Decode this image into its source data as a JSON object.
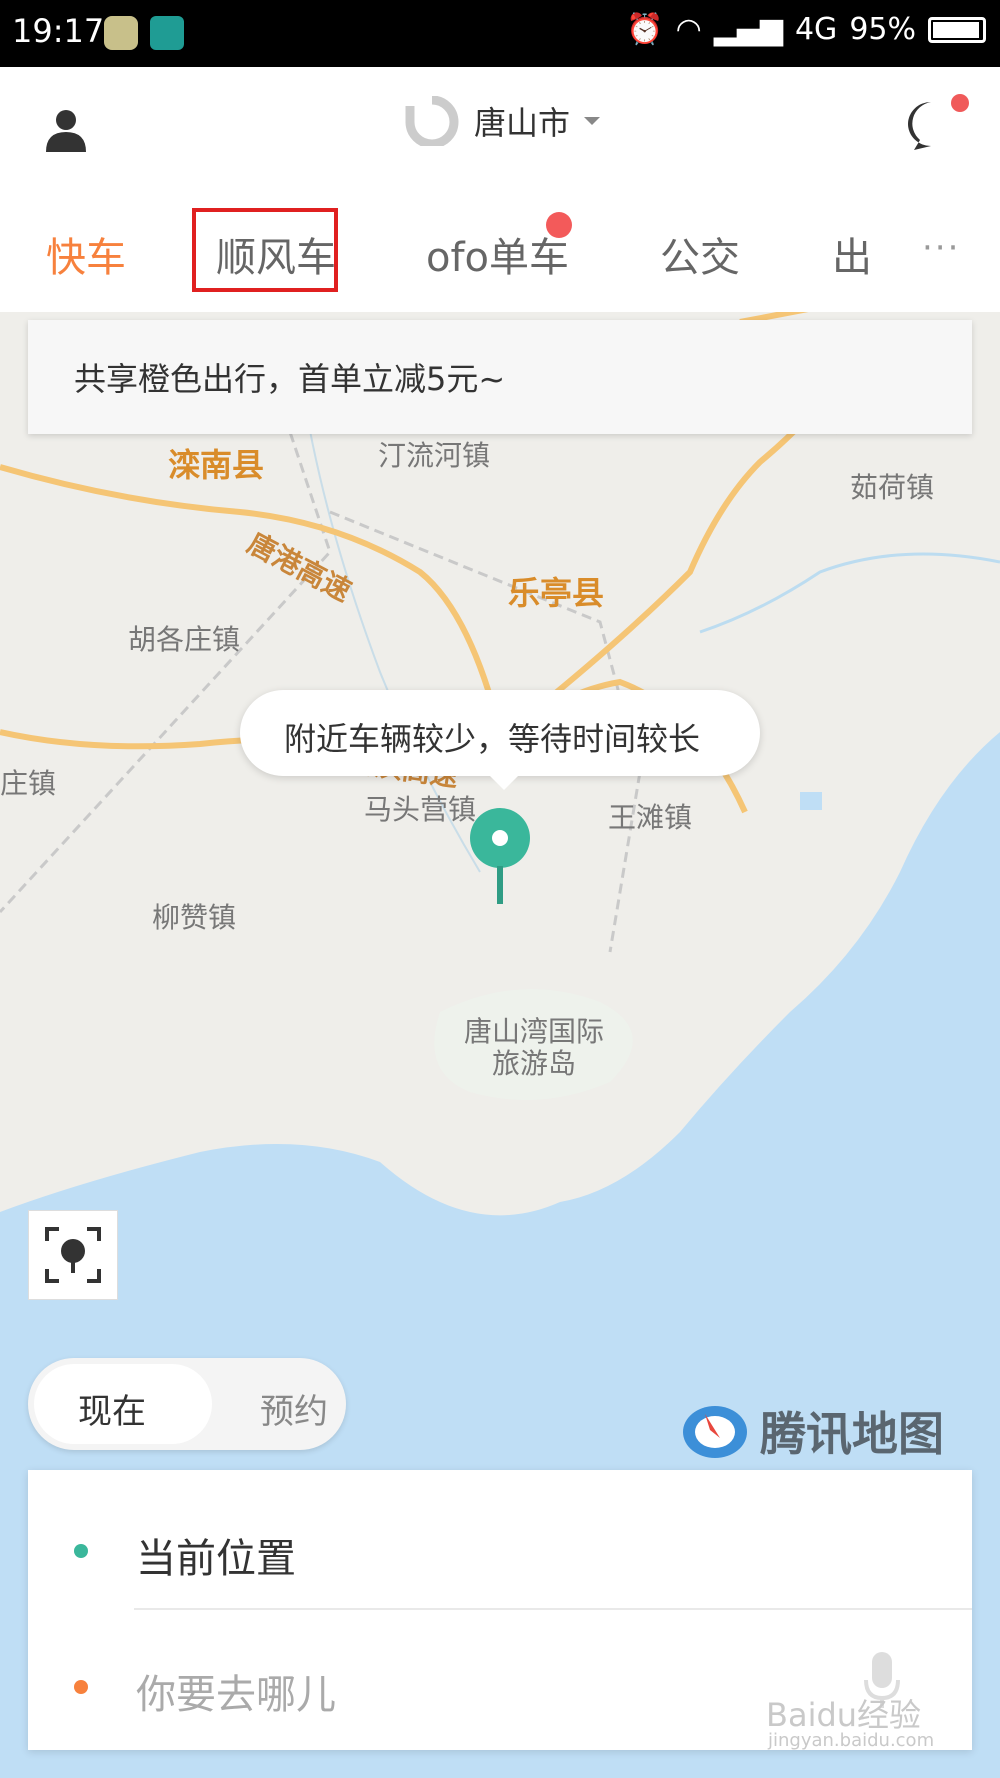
{
  "status_bar": {
    "time": "19:17",
    "network": "4G",
    "battery": "95%"
  },
  "header": {
    "city": "唐山市"
  },
  "tabs": [
    {
      "label": "快车"
    },
    {
      "label": "顺风车"
    },
    {
      "label": "ofo单车"
    },
    {
      "label": "公交"
    },
    {
      "label": "出"
    }
  ],
  "more_label": "···",
  "promo_text": "共享橙色出行，首单立减5元~",
  "map_labels": {
    "luannan": "滦南县",
    "tingliu": "汀流河镇",
    "ruhe": "茹荷镇",
    "tanggang": "唐港高速",
    "leting": "乐亭县",
    "hugezhuang": "胡各庄镇",
    "qinbin": "秦滨高速",
    "zhuangzhen": "庄镇",
    "matouying": "马头营镇",
    "wangtan": "王滩镇",
    "liuzan": "柳赞镇",
    "tsw1": "唐山湾国际",
    "tsw2": "旅游岛",
    "gaosu1": "高",
    "gaosu2": "速"
  },
  "bubble_text": "附近车辆较少，等待时间较长",
  "mode_toggle": {
    "now": "现在",
    "later": "预约"
  },
  "map_provider": "腾讯地图",
  "route": {
    "from": "当前位置",
    "to_placeholder": "你要去哪儿"
  },
  "watermark": {
    "main": "Baidu经验",
    "sub": "jingyan.baidu.com"
  },
  "colors": {
    "accent": "#f7813d",
    "pin": "#3ab79b",
    "sea": "#bfdef5",
    "road": "#f5c575",
    "highlight_box": "#e02020"
  }
}
